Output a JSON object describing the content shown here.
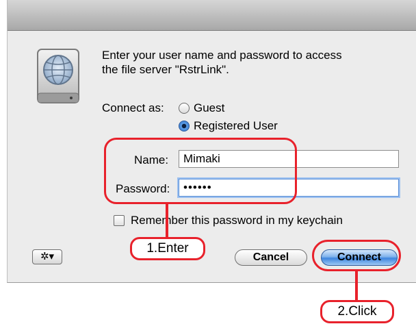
{
  "dialog": {
    "message_line1": "Enter your user name and password to access",
    "message_line2": "the file server \"RstrLink\"."
  },
  "connect_as": {
    "label": "Connect as:",
    "options": [
      {
        "label": "Guest",
        "selected": false
      },
      {
        "label": "Registered User",
        "selected": true
      }
    ]
  },
  "name_field": {
    "label": "Name:",
    "value": "Mimaki"
  },
  "password_field": {
    "label": "Password:",
    "value": "••••••"
  },
  "remember": {
    "label": "Remember this password in my keychain",
    "checked": false
  },
  "buttons": {
    "gear": "✲▾",
    "cancel": "Cancel",
    "connect": "Connect"
  },
  "callouts": {
    "enter": "1.Enter",
    "click": "2.Click"
  },
  "colors": {
    "annotation": "#e8212b",
    "default_button": "#3f86de",
    "dialog_bg": "#ececec"
  }
}
